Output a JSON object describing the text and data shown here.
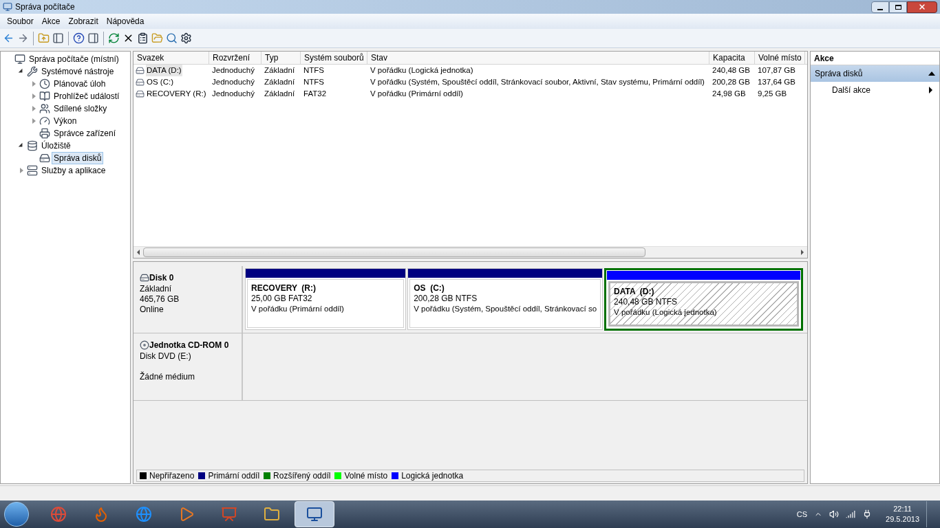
{
  "window": {
    "title": "Správa počítače"
  },
  "menu": [
    "Soubor",
    "Akce",
    "Zobrazit",
    "Nápověda"
  ],
  "tree": [
    {
      "label": "Správa počítače (místní)",
      "selected": false,
      "children": [
        {
          "label": "Systémové nástroje",
          "expanded": true,
          "selected": false,
          "children": [
            {
              "label": "Plánovač úloh",
              "expanded": false,
              "selected": false
            },
            {
              "label": "Prohlížeč událostí",
              "expanded": false,
              "selected": false
            },
            {
              "label": "Sdílené složky",
              "expanded": false,
              "selected": false
            },
            {
              "label": "Výkon",
              "expanded": false,
              "selected": false
            },
            {
              "label": "Správce zařízení",
              "selected": false
            }
          ]
        },
        {
          "label": "Úložiště",
          "expanded": true,
          "selected": false,
          "children": [
            {
              "label": "Správa disků",
              "selected": true
            }
          ]
        },
        {
          "label": "Služby a aplikace",
          "expanded": false,
          "selected": false
        }
      ]
    }
  ],
  "table": {
    "columns": [
      "Svazek",
      "Rozvržení",
      "Typ",
      "Systém souborů",
      "Stav",
      "Kapacita",
      "Volné místo"
    ],
    "rows": [
      {
        "selected": true,
        "cells": [
          "DATA (D:)",
          "Jednoduchý",
          "Základní",
          "NTFS",
          "V pořádku (Logická jednotka)",
          "240,48 GB",
          "107,87 GB"
        ]
      },
      {
        "selected": false,
        "cells": [
          "OS (C:)",
          "Jednoduchý",
          "Základní",
          "NTFS",
          "V pořádku (Systém, Spouštěcí oddíl, Stránkovací soubor, Aktivní, Stav systému, Primární oddíl)",
          "200,28 GB",
          "137,64 GB"
        ]
      },
      {
        "selected": false,
        "cells": [
          "RECOVERY (R:)",
          "Jednoduchý",
          "Základní",
          "FAT32",
          "V pořádku (Primární oddíl)",
          "24,98 GB",
          "9,25 GB"
        ]
      }
    ]
  },
  "disks": [
    {
      "kind": "disk",
      "name": "Disk 0",
      "lines": [
        "Základní",
        "465,76 GB",
        "Online"
      ],
      "partitions": [
        {
          "label": "RECOVERY  (R:)",
          "size": "25,00 GB FAT32",
          "status": "V pořádku (Primární oddíl)",
          "color": "#000080",
          "selected": false
        },
        {
          "label": "OS  (C:)",
          "size": "200,28 GB NTFS",
          "status": "V pořádku (Systém, Spouštěcí oddíl, Stránkovací so",
          "color": "#000080",
          "selected": false
        },
        {
          "label": "DATA  (D:)",
          "size": "240,48 GB NTFS",
          "status": "V pořádku (Logická jednotka)",
          "color": "#0000ff",
          "selected": true
        }
      ]
    },
    {
      "kind": "cdrom",
      "name": "Jednotka CD-ROM 0",
      "lines": [
        "Disk DVD (E:)",
        "Žádné médium"
      ]
    }
  ],
  "legend": [
    {
      "label": "Nepřiřazeno",
      "color": "#000000"
    },
    {
      "label": "Primární oddíl",
      "color": "#000080"
    },
    {
      "label": "Rozšířený oddíl",
      "color": "#008000"
    },
    {
      "label": "Volné místo",
      "color": "#00ff00"
    },
    {
      "label": "Logická jednotka",
      "color": "#0000ff"
    }
  ],
  "actions": {
    "title": "Akce",
    "sections": [
      {
        "label": "Správa disků",
        "expanded": true,
        "items": [
          "Další akce"
        ]
      }
    ]
  },
  "taskbar": {
    "apps": [
      {
        "selected": false
      },
      {
        "selected": false
      },
      {
        "selected": false
      },
      {
        "selected": false
      },
      {
        "selected": false
      },
      {
        "selected": false
      },
      {
        "selected": true
      }
    ],
    "language": "CS",
    "time": "22:11",
    "date": "29.5.2013"
  }
}
